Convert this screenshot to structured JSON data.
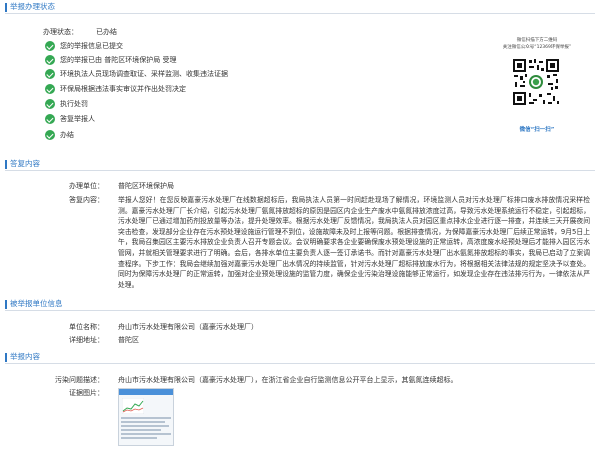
{
  "progress": {
    "section_title": "举报办理状态",
    "status_label": "办理状态：",
    "status_value": "已办结",
    "steps": [
      "您的举报信息已提交",
      "您的举报已由 普陀区环境保护局 受理",
      "环境执法人员现场调查取证、采样监测、收集违法证据",
      "环保局根据违法事实审议并作出处罚决定",
      "执行处罚",
      "答复举报人",
      "办结"
    ]
  },
  "qr": {
    "caption_line1": "微信扫描下方二维码",
    "caption_line2": "关注微信公众号“12369环保举报”",
    "scan_label": "微信“扫一扫”"
  },
  "reply": {
    "section_title": "答复内容",
    "unit_label": "办理单位：",
    "unit_value": "普陀区环境保护局",
    "content_label": "答复内容：",
    "content_text": "举报人您好！在您反映嘉豪污水处理厂在线数据超标后，我局执法人员第一时间赶赴现场了解情况，环境监测人员对污水处理厂标排口废水排放情况采样检测。嘉豪污水处理厂厂长介绍，引起污水处理厂氨氮排放超标的原因是园区内企业生产废水中氨氮排放浓度过高，导致污水处理系统运行不稳定，引起超标，污水处理厂已通过增加药剂投放量等办法，提升处理效率。根据污水处理厂反馈情况，我局执法人员对园区重点排水企业进行逐一排查，并连续三天开展夜间突击检查，发现部分企业存在污水预处理设施运行管理不到位，设施故障未及时上报等问题。根据排查情况，为保障嘉豪污水处理厂后续正常运转，9月5日上午，我局召集园区主要污水排放企业负责人召开专题会议。会议明确要求各企业要确保废水预处理设施的正常运转，高浓度废水经预处理后才能排入园区污水管网，并就相关管理要求进行了明确。会后，各排水单位主要负责人逐一签订承诺书。而针对嘉豪污水处理厂出水氨氮排放超标的事实，我局已启动了立案调查程序。下步工作：我局会继续加强对嘉豪污水处理厂出水情况的持续监管，针对污水处理厂超标排放废水行为，将根据相关法律法规的规定坚决予以查处。同时为保障污水处理厂的正常运转，加强对企业预处理设施的监管力度，确保企业污染治理设施能够正常运行，如发现企业存在违法排污行为，一律依法从严处理。"
  },
  "reported_unit": {
    "section_title": "被举报单位信息",
    "name_label": "单位名称：",
    "name_value": "舟山市污水处理有限公司（嘉豪污水处理厂）",
    "address_label": "详细地址：",
    "address_value": "普陀区"
  },
  "report": {
    "section_title": "举报内容",
    "desc_label": "污染问题描述：",
    "desc_value": "舟山市污水处理有限公司（嘉豪污水处理厂），在浙江省企业自行监测信息公开平台上显示，其氨氮连续超标。",
    "evidence_label": "证据图片："
  },
  "colors": {
    "accent": "#2f78c4",
    "success": "#34a853",
    "divider": "#d6dde6"
  }
}
